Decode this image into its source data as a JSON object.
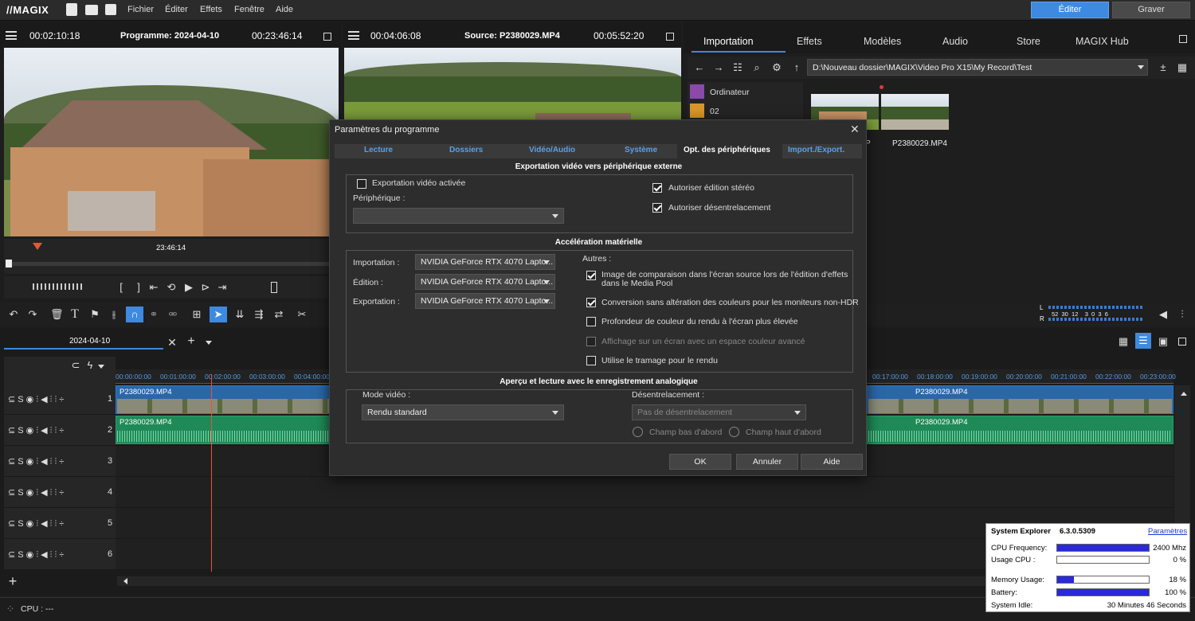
{
  "app": {
    "logo": "//MAGIX",
    "menu": [
      "Fichier",
      "Éditer",
      "Effets",
      "Fenêtre",
      "Aide"
    ],
    "mode_edit": "Éditer",
    "mode_burn": "Graver"
  },
  "program_monitor": {
    "time_left": "00:02:10:18",
    "title": "Programme: 2024-04-10",
    "time_right": "00:23:46:14",
    "ruler_time": "23:46:14"
  },
  "source_monitor": {
    "time_left": "00:04:06:08",
    "title": "Source: P2380029.MP4",
    "time_right": "00:05:52:20"
  },
  "media_pool": {
    "tabs": [
      "Importation",
      "Effets",
      "Modèles",
      "Audio",
      "Store",
      "MAGIX Hub"
    ],
    "path": "D:\\Nouveau dossier\\MAGIX\\Video Pro X15\\My Record\\Test",
    "tree": [
      "Ordinateur",
      "02"
    ],
    "thumb_labels": [
      "P",
      "P2380029.MP4"
    ]
  },
  "dialog": {
    "title": "Paramètres du programme",
    "tabs": [
      "Lecture",
      "Dossiers",
      "Vidéo/Audio",
      "Système",
      "Opt. des périphériques",
      "Import./Export."
    ],
    "section1": "Exportation vidéo vers périphérique externe",
    "export_enabled": "Exportation vidéo activée",
    "device_label": "Périphérique :",
    "device_value": "",
    "stereo": "Autoriser édition stéréo",
    "deinterlace_allow": "Autoriser désentrelacement",
    "section2": "Accélération matérielle",
    "import_label": "Importation :",
    "edit_label": "Édition :",
    "export_label": "Exportation :",
    "gpu": "NVIDIA GeForce RTX 4070 Lapto...",
    "others": "Autres :",
    "opt1": "Image de comparaison dans l'écran source lors de l'édition d'effets dans le Media Pool",
    "opt2": "Conversion sans altération des couleurs pour les moniteurs non-HDR",
    "opt3": "Profondeur de couleur du rendu à l'écran plus élevée",
    "opt4": "Affichage sur un écran avec un espace couleur avancé",
    "opt5": "Utilise le tramage pour le rendu",
    "section3": "Aperçu et lecture avec le enregistrement analogique",
    "video_mode_label": "Mode vidéo :",
    "video_mode_value": "Rendu standard",
    "deint_label": "Désentrelacement :",
    "deint_value": "Pas de désentrelacement",
    "field_low": "Champ bas d'abord",
    "field_high": "Champ haut d'abord",
    "ok": "OK",
    "cancel": "Annuler",
    "help": "Aide"
  },
  "timeline": {
    "tab": "2024-04-10",
    "ruler_left": [
      "00:00:00:00",
      "00:01:00:00",
      "00:02:00:00",
      "00:03:00:00",
      "00:04:00:00"
    ],
    "ruler_right": [
      "00:17:00:00",
      "00:18:00:00",
      "00:19:00:00",
      "00:20:00:00",
      "00:21:00:00",
      "00:22:00:00",
      "00:23:00:00"
    ],
    "tracks": [
      "1",
      "2",
      "3",
      "4",
      "5",
      "6"
    ],
    "clip_name": "P2380029.MP4",
    "meter_scale": "52  30  12    3  0  3  6"
  },
  "status": {
    "cpu": "CPU : ---"
  },
  "system_explorer": {
    "title": "System Explorer",
    "version": "6.3.0.5309",
    "settings": "Paramètres",
    "cpu_freq_label": "CPU Frequency:",
    "cpu_freq": "2400 Mhz",
    "cpu_freq_pct": 100,
    "usage_label": "Usage CPU :",
    "usage": "0 %",
    "usage_pct": 0,
    "mem_label": "Memory Usage:",
    "mem": "18 %",
    "mem_pct": 18,
    "batt_label": "Battery:",
    "batt": "100 %",
    "batt_pct": 100,
    "idle_label": "System Idle:",
    "idle": "30 Minutes 46 Seconds"
  }
}
